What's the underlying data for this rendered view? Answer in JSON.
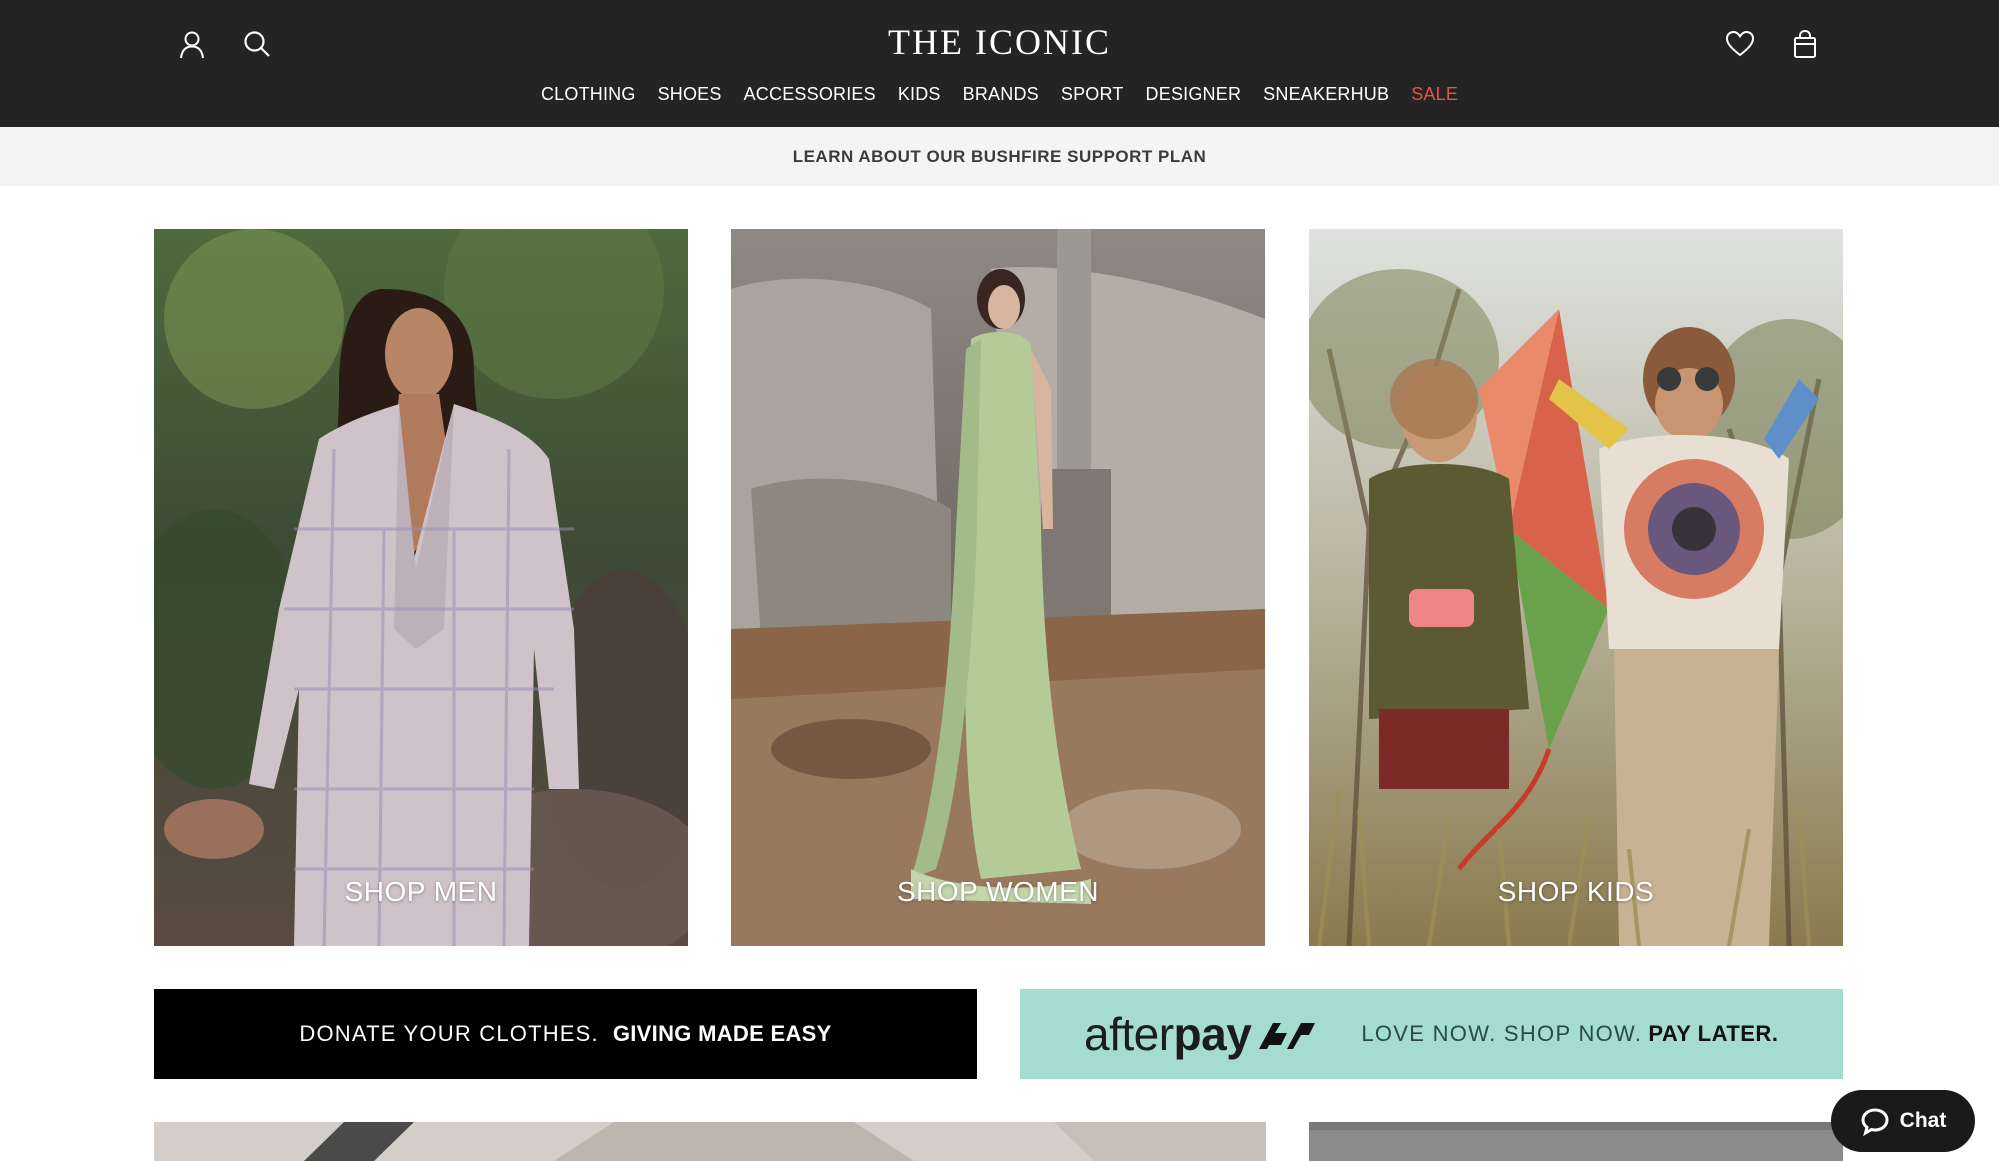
{
  "header": {
    "brand": "THE ICONIC",
    "account_icon": "user-icon",
    "search_icon": "search-icon",
    "wishlist_icon": "heart-icon",
    "bag_icon": "shopping-bag-icon",
    "nav": [
      {
        "label": "CLOTHING"
      },
      {
        "label": "SHOES"
      },
      {
        "label": "ACCESSORIES"
      },
      {
        "label": "KIDS"
      },
      {
        "label": "BRANDS"
      },
      {
        "label": "SPORT"
      },
      {
        "label": "DESIGNER"
      },
      {
        "label": "SNEAKERHUB"
      },
      {
        "label": "SALE",
        "highlight_color": "#e8534a"
      }
    ]
  },
  "promo": {
    "text": "LEARN ABOUT OUR BUSHFIRE SUPPORT PLAN"
  },
  "tiles": [
    {
      "label": "SHOP MEN"
    },
    {
      "label": "SHOP WOMEN"
    },
    {
      "label": "SHOP KIDS"
    }
  ],
  "banners": {
    "donate": {
      "text": "DONATE YOUR CLOTHES.",
      "strong": "GIVING MADE EASY"
    },
    "afterpay": {
      "logo_after": "after",
      "logo_pay": "pay",
      "text": "LOVE NOW. SHOP NOW.",
      "strong": "PAY LATER."
    }
  },
  "chat": {
    "label": "Chat",
    "icon": "chat-bubble-icon"
  },
  "colors": {
    "header_bg": "#242424",
    "sale": "#e8534a",
    "afterpay_bg": "#a5dcd0",
    "promo_bg": "#f4f4f4"
  }
}
